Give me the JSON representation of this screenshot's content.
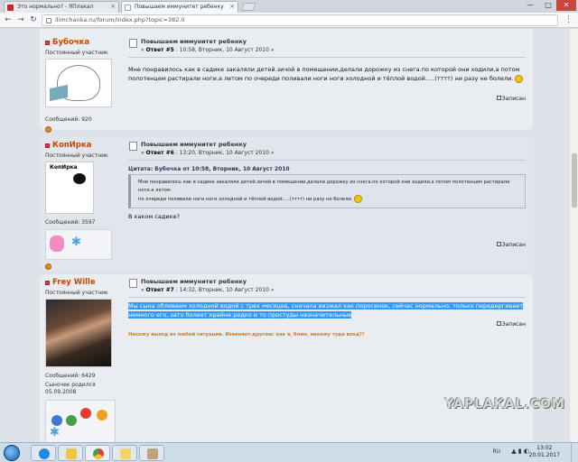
{
  "browser": {
    "tabs": [
      {
        "label": "Это нормально? - ЯПлакал",
        "favicon_color": "#c62828"
      },
      {
        "label": "Повышаем иммунитет ребенку",
        "favicon_color": "#9e9e9e"
      }
    ],
    "url": "ilimchanka.ru/forum/index.php?topic=382.0",
    "window_controls": [
      "—",
      "□",
      "✕"
    ]
  },
  "posts": [
    {
      "author": "Бубочка",
      "rank": "Постоянный участник",
      "messages": "Сообщений: 920",
      "title": "Повышаем иммунитет ребенку",
      "meta_prefix": "« ",
      "meta_answer": "Ответ #5",
      "meta_rest": " : 10:58, Вторник, 10 Август 2010 »",
      "body_1": "Мне понравилось как в садике закаляли детей.зичой в помещении,делали дорожку из снега.по которой они ходили,а потом",
      "body_2": "полотенцем растирали ноги.а летом по очереди поливали ноги ноги холодной и тёплой водой.....(тттт) ни разу не болели.",
      "record": "Записан"
    },
    {
      "author": "КопИрка",
      "rank": "Постоянный участник",
      "avatar_label": "КопИрка",
      "messages": "Сообщений: 3597",
      "title": "Повышаем иммунитет ребенку",
      "meta_prefix": "« ",
      "meta_answer": "Ответ #6",
      "meta_rest": " : 13:20, Вторник, 10 Август 2010 »",
      "quote_head": "Цитата: Бубочка от 10:58, Вторник, 10 Август 2010",
      "quote_1": "Мне понравилось как в садике закаляли детей.зичой в помещении,делали дорожку из снега.по которой они ходили,а потом полотенцем растирали ноги.а летом",
      "quote_2": "по очереди поливали ноги ноги холодной и тёплой водой.....(тттт) ни разу не болели.",
      "body": "В каком садике?",
      "record": "Записан"
    },
    {
      "author": "Frey Wille",
      "rank": "Постоянный участник",
      "messages": "Сообщений: 6429",
      "extra_1": "Сыночек родился",
      "extra_2": "05.09.2008",
      "title": "Повышаем иммунитет ребенку",
      "meta_prefix": "« ",
      "meta_answer": "Ответ #7",
      "meta_rest": " : 14:32, Вторник, 10 Август 2010 »",
      "body_1": "Мы сына обливаем холодной водой с трех месяцев, сначала визжал как поросенок, сейчас нормально, только передергивает",
      "body_2": "немного его, зато болеет крайне редко и то простуды незначительные",
      "record": "Записан",
      "signature": "Нахожу выход из любой ситуации. Извеняет-другою: как в, блин, нахожу туда вход?!"
    }
  ],
  "watermark": "YAPLAKAL.COM",
  "taskbar": {
    "lang": "RU",
    "time": "13:02",
    "date": "20.01.2017"
  }
}
